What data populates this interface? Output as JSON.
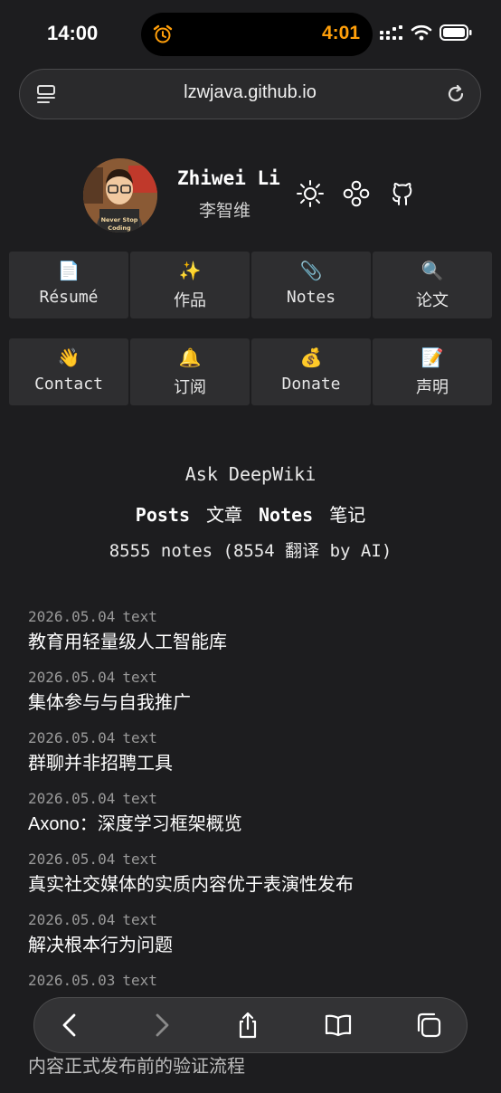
{
  "status_bar": {
    "time": "14:00",
    "timer": "4:01"
  },
  "browser": {
    "url": "lzwjava.github.io"
  },
  "profile": {
    "name": "Zhiwei Li",
    "name_cn": "李智维",
    "avatar_text_1": "Never Stop",
    "avatar_text_2": "Coding"
  },
  "nav_rows": [
    [
      {
        "icon": "📄",
        "label": "Résumé"
      },
      {
        "icon": "✨",
        "label": "作品"
      },
      {
        "icon": "📎",
        "label": "Notes"
      },
      {
        "icon": "🔍",
        "label": "论文"
      }
    ],
    [
      {
        "icon": "👋",
        "label": "Contact"
      },
      {
        "icon": "🔔",
        "label": "订阅"
      },
      {
        "icon": "💰",
        "label": "Donate"
      },
      {
        "icon": "📝",
        "label": "声明"
      }
    ]
  ],
  "ask_link": "Ask DeepWiki",
  "links": {
    "posts": "Posts",
    "posts_cn": "文章",
    "notes": "Notes",
    "notes_cn": "笔记"
  },
  "count": "8555 notes (8554 翻译 by AI)",
  "posts": [
    {
      "date": "2026.05.04",
      "type": "text",
      "title": "教育用轻量级人工智能库"
    },
    {
      "date": "2026.05.04",
      "type": "text",
      "title": "集体参与与自我推广"
    },
    {
      "date": "2026.05.04",
      "type": "text",
      "title": "群聊并非招聘工具"
    },
    {
      "date": "2026.05.04",
      "type": "text",
      "title": "Axono：深度学习框架概览"
    },
    {
      "date": "2026.05.04",
      "type": "text",
      "title": "真实社交媒体的实质内容优于表演性发布"
    },
    {
      "date": "2026.05.04",
      "type": "text",
      "title": "解决根本行为问题"
    },
    {
      "date": "2026.05.03",
      "type": "text",
      "title": ""
    },
    {
      "date": "",
      "type": "",
      "title": "内容正式发布前的验证流程"
    }
  ]
}
